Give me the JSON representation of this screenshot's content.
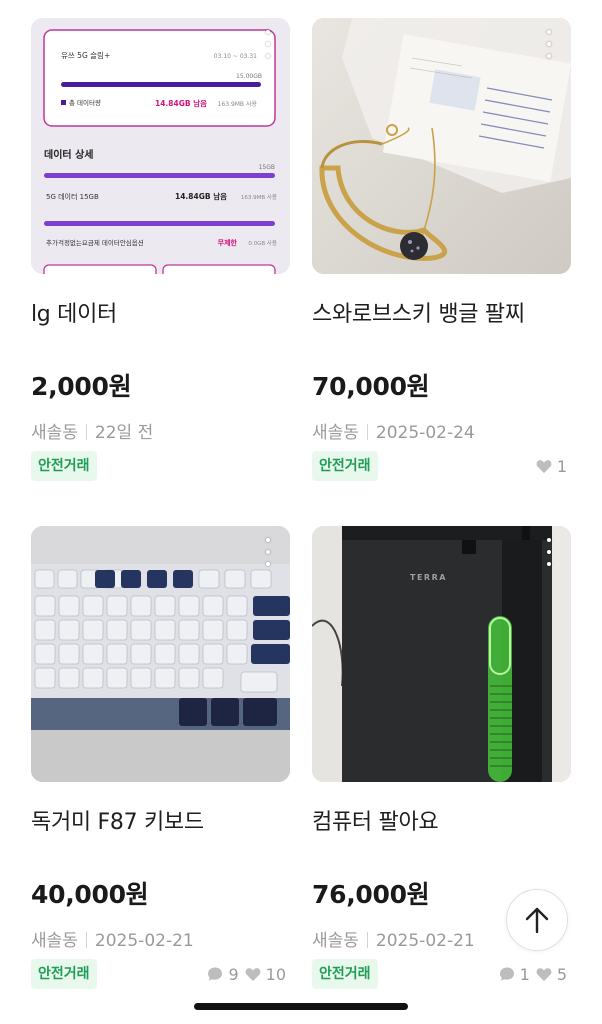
{
  "products": [
    {
      "title": "lg 데이터",
      "price": "2,000원",
      "location": "새솔동",
      "time": "22일 전",
      "badge": "안전거래",
      "chats": null,
      "likes": null,
      "image_text": {
        "plan": "유쓰 5G 슬림+",
        "period": "03.10 ~ 03.31",
        "total": "15.00GB",
        "total_label": "총 데이터량",
        "remain": "14.84GB 남음",
        "used": "163.9MB 사용",
        "section": "데이터 상세",
        "cap": "15GB",
        "line1_label": "5G 데이터 15GB",
        "line1_remain": "14.84GB 남음",
        "line1_used": "163.9MB 사용",
        "line2_label": "추가걱정없는요금제 데이터안심옵션",
        "line2_remain": "무제한",
        "line2_used": "0.0GB 사용"
      }
    },
    {
      "title": "스와로브스키 뱅글 팔찌",
      "price": "70,000원",
      "location": "새솔동",
      "time": "2025-02-24",
      "badge": "안전거래",
      "chats": null,
      "likes": "1"
    },
    {
      "title": "독거미 F87 키보드",
      "price": "40,000원",
      "location": "새솔동",
      "time": "2025-02-21",
      "badge": "안전거래",
      "chats": "9",
      "likes": "10"
    },
    {
      "title": "컴퓨터 팔아요",
      "price": "76,000원",
      "location": "새솔동",
      "time": "2025-02-21",
      "badge": "안전거래",
      "chats": "1",
      "likes": "5",
      "image_text": {
        "brand": "TERRA"
      }
    }
  ],
  "icons": {
    "more": "more-vertical-icon",
    "chat": "chat-bubble-icon",
    "like": "heart-icon",
    "scroll_top": "arrow-up-icon"
  },
  "colors": {
    "badge_bg": "#e8f8ec",
    "badge_text": "#1f9d55",
    "meta_text": "#9a9a9a",
    "accent_purple": "#5b2ab5",
    "accent_pink": "#d4147a"
  }
}
